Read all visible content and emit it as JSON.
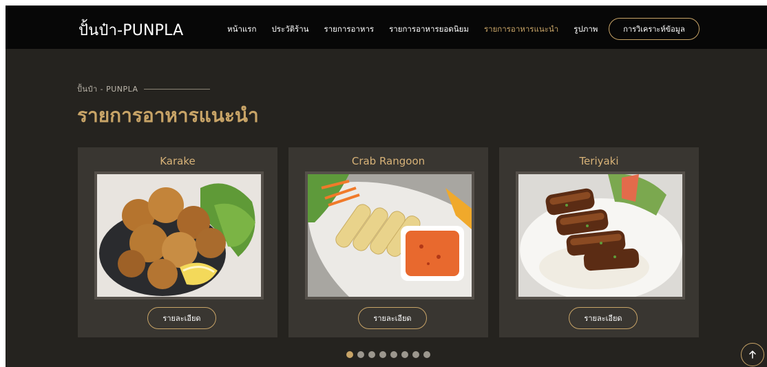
{
  "brand": "ปั้นป๋า-PUNPLA",
  "nav": {
    "items": [
      {
        "label": "หน้าแรก"
      },
      {
        "label": "ประวัติร้าน"
      },
      {
        "label": "รายการอาหาร"
      },
      {
        "label": "รายการอาหารยอดนิยม"
      },
      {
        "label": "รายการอาหารแนะนำ",
        "active": true
      },
      {
        "label": "รูปภาพ"
      }
    ],
    "cta_label": "การวิเคราะห์ข้อมูล"
  },
  "breadcrumb": "ปั้นป๋า - PUNPLA",
  "section_title": "รายการอาหารแนะนำ",
  "cards": [
    {
      "title": "Karake",
      "button_label": "รายละเอียด",
      "image_icon": "fried-chicken-photo"
    },
    {
      "title": "Crab Rangoon",
      "button_label": "รายละเอียด",
      "image_icon": "spring-rolls-photo"
    },
    {
      "title": "Teriyaki",
      "button_label": "รายละเอียด",
      "image_icon": "teriyaki-photo"
    }
  ],
  "carousel": {
    "total": 8,
    "active_index": 0
  },
  "colors": {
    "accent": "#c8a467",
    "background": "#25231f",
    "card": "#393631",
    "topbar": "#070707"
  }
}
